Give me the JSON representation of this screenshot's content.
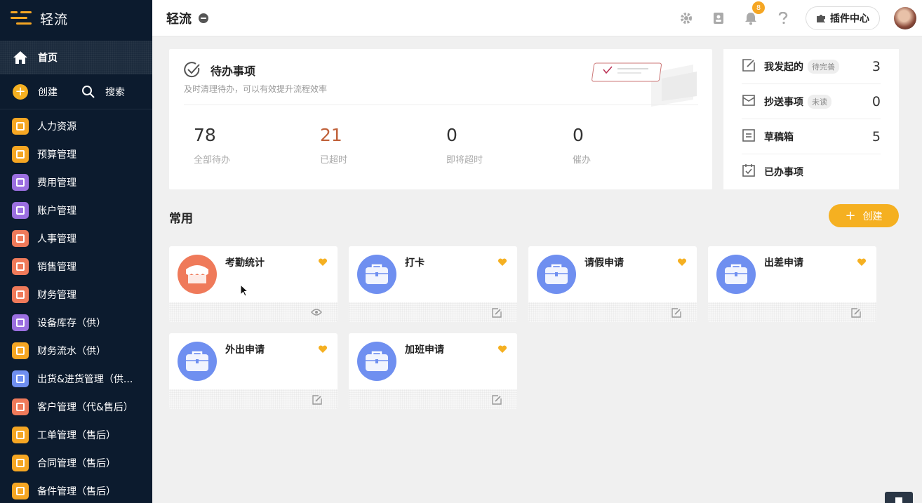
{
  "app": {
    "title": "轻流"
  },
  "colors": {
    "accent": "#f5b021",
    "sidebar_bg": "#0c1b2e",
    "overdue": "#c0613a"
  },
  "sidebar": {
    "home": {
      "label": "首页",
      "icon": "home-icon"
    },
    "create_label": "创建",
    "search_label": "搜索",
    "items": [
      {
        "label": "人力资源",
        "color": "#f5a623",
        "icon": "flask-icon"
      },
      {
        "label": "预算管理",
        "color": "#f5a623",
        "icon": "ledger-icon"
      },
      {
        "label": "费用管理",
        "color": "#9b6fe0",
        "icon": "robot-icon"
      },
      {
        "label": "账户管理",
        "color": "#9b6fe0",
        "icon": "robot-icon"
      },
      {
        "label": "人事管理",
        "color": "#ef7a5a",
        "icon": "building-icon"
      },
      {
        "label": "销售管理",
        "color": "#ef7a5a",
        "icon": "phone-icon"
      },
      {
        "label": "财务管理",
        "color": "#ef7a5a",
        "icon": "document-icon"
      },
      {
        "label": "设备库存（供）",
        "color": "#9b6fe0",
        "icon": "robot-icon"
      },
      {
        "label": "财务流水（供）",
        "color": "#f5a623",
        "icon": "ledger-icon"
      },
      {
        "label": "出货&进货管理（供...",
        "color": "#6f8ff0",
        "icon": "gear-box-icon"
      },
      {
        "label": "客户管理（代&售后）",
        "color": "#ef7a5a",
        "icon": "building-icon"
      },
      {
        "label": "工单管理（售后）",
        "color": "#f5a623",
        "icon": "list-icon"
      },
      {
        "label": "合同管理（售后）",
        "color": "#f5a623",
        "icon": "crown-icon"
      },
      {
        "label": "备件管理（售后）",
        "color": "#f5a623",
        "icon": "flask-icon"
      }
    ]
  },
  "header": {
    "notification_count": "8",
    "plugin_label": "插件中心"
  },
  "todo": {
    "title": "待办事项",
    "subtitle": "及时清理待办，可以有效提升流程效率",
    "stats": [
      {
        "value": "78",
        "label": "全部待办"
      },
      {
        "value": "21",
        "label": "已超时"
      },
      {
        "value": "0",
        "label": "即将超时"
      },
      {
        "value": "0",
        "label": "催办"
      }
    ]
  },
  "side_panel": [
    {
      "label": "我发起的",
      "tag": "待完善",
      "count": "3",
      "icon": "edit-doc-icon"
    },
    {
      "label": "抄送事项",
      "tag": "未读",
      "count": "0",
      "icon": "inbox-icon"
    },
    {
      "label": "草稿箱",
      "tag": "",
      "count": "5",
      "icon": "draft-box-icon"
    },
    {
      "label": "已办事项",
      "tag": "",
      "count": "",
      "icon": "calendar-check-icon"
    }
  ],
  "common": {
    "title": "常用",
    "create_label": "创建",
    "apps": [
      {
        "name": "考勤统计",
        "icon": "shop-icon",
        "color": "#ef7a5a",
        "footer_icon": "eye-icon"
      },
      {
        "name": "打卡",
        "icon": "briefcase-icon",
        "color": "#6f8ff0",
        "footer_icon": "edit-icon"
      },
      {
        "name": "请假申请",
        "icon": "briefcase-icon",
        "color": "#6f8ff0",
        "footer_icon": "edit-icon"
      },
      {
        "name": "出差申请",
        "icon": "briefcase-icon",
        "color": "#6f8ff0",
        "footer_icon": "edit-icon"
      },
      {
        "name": "外出申请",
        "icon": "briefcase-icon",
        "color": "#6f8ff0",
        "footer_icon": "edit-icon"
      },
      {
        "name": "加班申请",
        "icon": "briefcase-icon",
        "color": "#6f8ff0",
        "footer_icon": "edit-icon"
      }
    ]
  }
}
